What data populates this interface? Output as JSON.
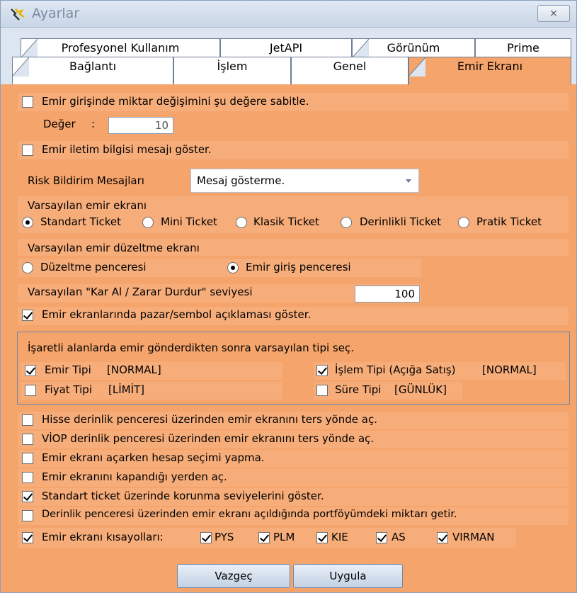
{
  "window": {
    "title": "Ayarlar",
    "close_glyph": "⨯",
    "close_icon": "close-icon"
  },
  "tabs_row1": [
    "Profesyonel Kullanım",
    "JetAPI",
    "Görünüm",
    "Prime"
  ],
  "tabs_row2": [
    "Bağlantı",
    "İşlem",
    "Genel",
    "Emir Ekranı"
  ],
  "active_tab": "Emir Ekranı",
  "fix_qty": {
    "label": "Emir girişinde miktar değişimini şu değere sabitle.",
    "checked": false
  },
  "deger": {
    "label": "Değer",
    "colon": ":",
    "value": "10"
  },
  "iletim": {
    "label": "Emir iletim bilgisi mesajı göster.",
    "checked": false
  },
  "risk": {
    "label": "Risk Bildirim Mesajları",
    "value": "Mesaj gösterme."
  },
  "default_screen": {
    "label": "Varsayılan emir ekranı",
    "options": [
      "Standart Ticket",
      "Mini Ticket",
      "Klasik Ticket",
      "Derinlikli Ticket",
      "Pratik Ticket"
    ],
    "selected": "Standart Ticket"
  },
  "default_edit": {
    "label": "Varsayılan emir düzeltme ekranı",
    "options": [
      "Düzeltme penceresi",
      "Emir giriş penceresi"
    ],
    "selected": "Emir giriş penceresi"
  },
  "karzarar": {
    "label": "Varsayılan \"Kar Al / Zarar Durdur\" seviyesi",
    "value": "100"
  },
  "pazar": {
    "label": "Emir ekranlarında pazar/sembol açıklaması göster.",
    "checked": true
  },
  "group": {
    "title": "İşaretli alanlarda emir gönderdikten sonra varsayılan tipi seç.",
    "emir_tipi": {
      "label": "Emir Tipi",
      "value": "[NORMAL]",
      "checked": true
    },
    "fiyat_tipi": {
      "label": "Fiyat Tipi",
      "value": "[LİMİT]",
      "checked": false
    },
    "islem_tipi": {
      "label": "İşlem Tipi (Açığa Satış)",
      "value": "[NORMAL]",
      "checked": true
    },
    "sure_tipi": {
      "label": "Süre Tipi",
      "value": "[GÜNLÜK]",
      "checked": false
    }
  },
  "options": [
    {
      "label": "Hisse derinlik penceresi üzerinden emir ekranını ters yönde aç.",
      "checked": false
    },
    {
      "label": "VİOP derinlik penceresi üzerinden emir ekranını ters yönde aç.",
      "checked": false
    },
    {
      "label": "Emir ekranı açarken hesap seçimi yapma.",
      "checked": false
    },
    {
      "label": "Emir ekranını kapandığı yerden aç.",
      "checked": false
    },
    {
      "label": "Standart ticket üzerinde korunma seviyelerini göster.",
      "checked": true
    },
    {
      "label": "Derinlik penceresi üzerinden emir ekranı açıldığında portföyümdeki miktarı getir.",
      "checked": false
    }
  ],
  "shortcuts": {
    "label": "Emir ekranı kısayolları:",
    "checked": true,
    "items": [
      "PYS",
      "PLM",
      "KIE",
      "AS",
      "VIRMAN"
    ]
  },
  "buttons": {
    "cancel": "Vazgeç",
    "apply": "Uygula"
  }
}
